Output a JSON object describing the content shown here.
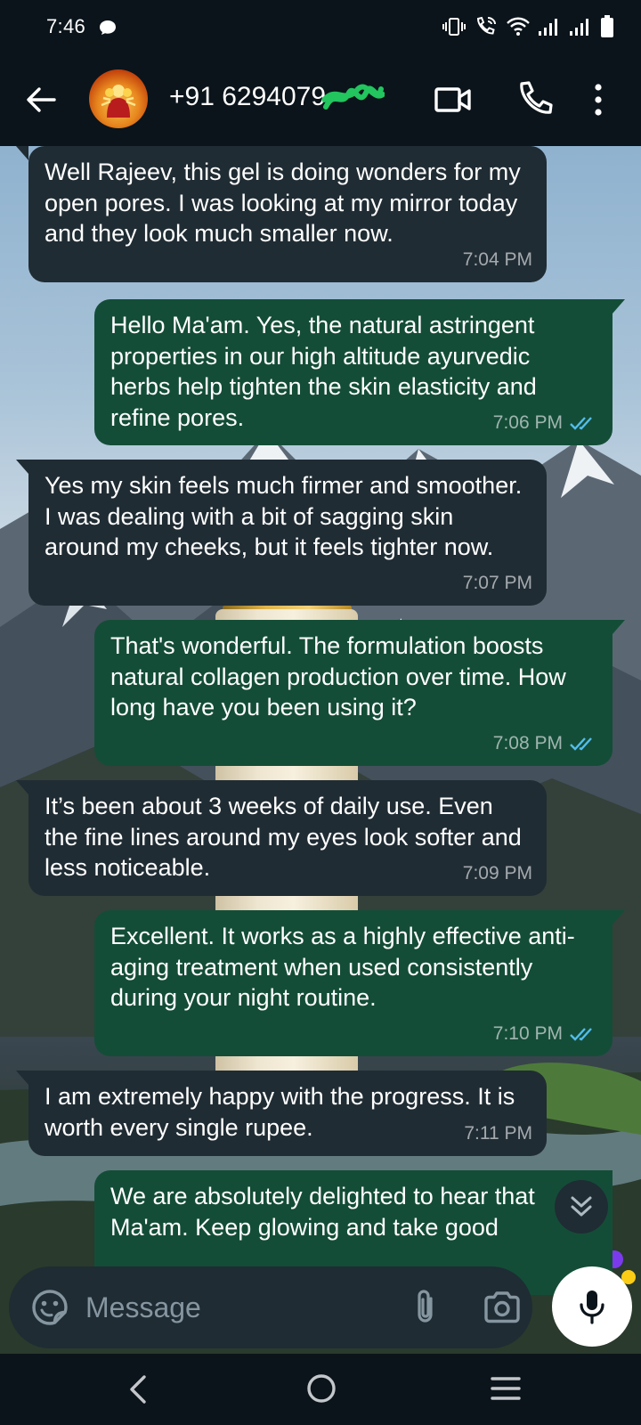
{
  "status_bar": {
    "time": "7:46",
    "icons": [
      "chat-bubble-icon",
      "vibrate-icon",
      "wifi-call-icon",
      "wifi-icon",
      "signal-icon",
      "signal-icon",
      "battery-icon"
    ]
  },
  "header": {
    "contact": "+91 6294079",
    "icons": [
      "back-arrow-icon",
      "video-call-icon",
      "phone-icon",
      "more-vert-icon"
    ]
  },
  "colors": {
    "incoming_bubble": "#202c33",
    "outgoing_bubble": "#144d37",
    "read_ticks": "#53bdeb",
    "background": "#0b141a"
  },
  "messages": [
    {
      "direction": "in",
      "text": "Well Rajeev, this gel is doing wonders for my open pores. I was looking at my mirror today and they look much smaller now.",
      "time": "7:04 PM"
    },
    {
      "direction": "out",
      "text": "Hello Ma'am. Yes, the natural astringent properties in our high altitude ayurvedic herbs help tighten the skin elasticity and refine pores.",
      "time": "7:06 PM",
      "status": "read"
    },
    {
      "direction": "in",
      "text": "Yes my skin feels much firmer and smoother. I was dealing with a bit of sagging skin around my cheeks, but it feels tighter now.",
      "time": "7:07 PM"
    },
    {
      "direction": "out",
      "text": "That's wonderful. The formulation boosts natural collagen production over time. How long have you been using it?",
      "time": "7:08 PM",
      "status": "read"
    },
    {
      "direction": "in",
      "text": "It’s been about 3 weeks of daily use. Even the fine lines around my eyes look softer and less noticeable.",
      "time": "7:09 PM"
    },
    {
      "direction": "out",
      "text": "Excellent. It works as a highly effective anti-aging treatment when used consistently during your night routine.",
      "time": "7:10 PM",
      "status": "read"
    },
    {
      "direction": "in",
      "text": "I am extremely happy with the progress. It is worth every single rupee.",
      "time": "7:11 PM"
    },
    {
      "direction": "out",
      "text": "We are absolutely delighted to hear that Ma'am. Keep glowing and take good",
      "time": "",
      "status": ""
    }
  ],
  "composer": {
    "placeholder": "Message",
    "icons": [
      "emoji-icon",
      "attach-icon",
      "camera-icon",
      "mic-icon"
    ]
  },
  "nav_bar": {
    "icons": [
      "nav-back-icon",
      "nav-home-icon",
      "nav-recents-icon"
    ]
  }
}
